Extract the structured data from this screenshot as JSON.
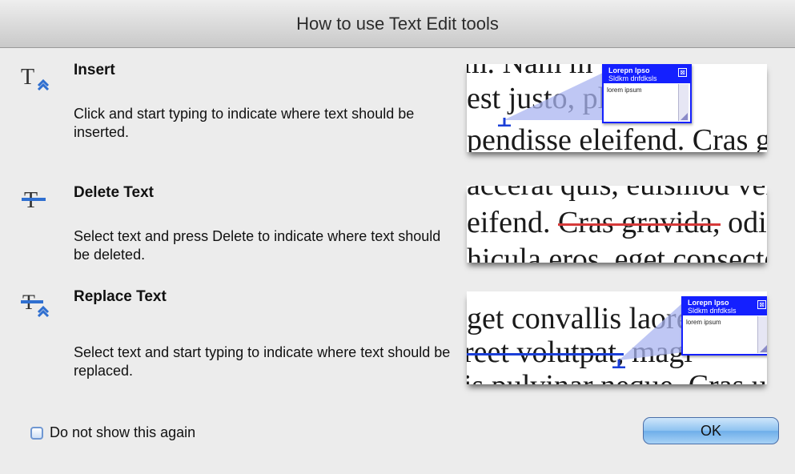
{
  "window": {
    "title": "How to use Text Edit tools"
  },
  "rows": [
    {
      "icon": "insert-text-icon",
      "title": "Insert",
      "description": "Click and start typing to indicate where text should be inserted.",
      "sample_lines": [
        "m. Nam m",
        "est justo, pl",
        "pendisse eleifend. Cras g"
      ],
      "note": {
        "header1": "Lorepn lpso",
        "header2": "Sldkm dnfdksls",
        "body": "lorem ipsum",
        "close": "⊠"
      }
    },
    {
      "icon": "delete-text-icon",
      "title": "Delete Text",
      "description": "Select text and press Delete to indicate where text should be deleted.",
      "sample_lines": [
        "accerat quis, euismod vel,",
        "eifend.",
        "Cras gravida,",
        "odic",
        "hicula eros, eget consecte"
      ]
    },
    {
      "icon": "replace-text-icon",
      "title": "Replace Text",
      "description": "Select text and start typing to indicate where text should be replaced.",
      "sample_lines": [
        "get convallis laore",
        "reet volutpat,",
        "magi",
        "is pulvinar neque. Cras u"
      ],
      "note": {
        "header1": "Lorepn lpso",
        "header2": "Sldkm dnfdksls",
        "body": "lorem ipsum",
        "close": "⊠"
      }
    }
  ],
  "footer": {
    "checkbox_label": "Do not show this again",
    "checkbox_checked": false,
    "ok_label": "OK"
  },
  "colors": {
    "note_blue": "#1420ff",
    "delete_red": "#d63a3a",
    "ok_button": "#8ec2f0"
  }
}
